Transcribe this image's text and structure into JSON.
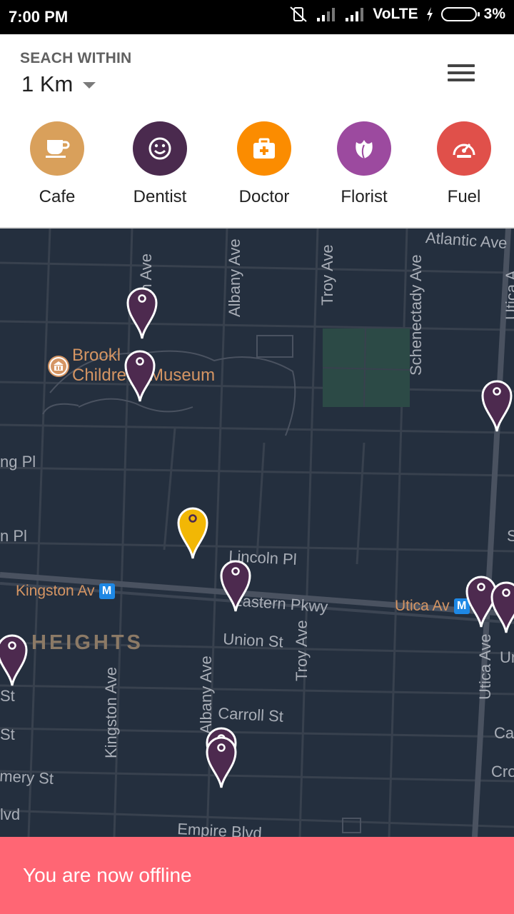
{
  "status_bar": {
    "time": "7:00 PM",
    "network": "VoLTE",
    "battery": "3%"
  },
  "header": {
    "search_label": "SEACH WITHIN",
    "distance_value": "1 Km",
    "menu_icon": "hamburger-menu-icon"
  },
  "categories": [
    {
      "label": "Cafe",
      "color": "#d9a05b",
      "icon": "coffee-cup-icon"
    },
    {
      "label": "Dentist",
      "color": "#4a2a4e",
      "icon": "smiley-icon"
    },
    {
      "label": "Doctor",
      "color": "#fb8c00",
      "icon": "medical-kit-icon"
    },
    {
      "label": "Florist",
      "color": "#9c4a9f",
      "icon": "flower-icon"
    },
    {
      "label": "Fuel",
      "color": "#e0504a",
      "icon": "speedometer-icon"
    }
  ],
  "map": {
    "streets": {
      "atlantic": "Atlantic Ave",
      "brooklyn_ave_top": "ton Ave",
      "albany_top": "Albany Ave",
      "troy_top": "Troy Ave",
      "schenectady": "Schenectady Ave",
      "utica_top": "Utica A",
      "sterling": "ng Pl",
      "st_johns": "n Pl",
      "lincoln": "Lincoln Pl",
      "eastern": "Eastern Pkwy",
      "union": "Union St",
      "troy_bottom": "Troy Ave",
      "utica_bottom": "Utica Ave",
      "kingston_ave": "Kingston Ave",
      "albany_bottom": "Albany Ave",
      "carroll": "Carroll St",
      "montgomery": "mery St",
      "empire": "Empire Blvd",
      "left_st1": "St",
      "left_st2": "St",
      "left_blvd": "lvd",
      "right_s": "S",
      "right_un": "Un",
      "right_ca": "Ca",
      "right_cro": "Cro"
    },
    "places": {
      "museum_line1": "Brookl",
      "museum_line2": "Childre  s Museum",
      "kingston_station": "Kingston Av",
      "utica_station": "Utica Av",
      "metro_mark": "M",
      "neighborhood": "HEIGHTS"
    },
    "pin_colors": {
      "default": "#4d2a4f",
      "selected": "#f2b705"
    }
  },
  "offline_banner": {
    "text": "You are now offline",
    "color": "#ff6674"
  }
}
